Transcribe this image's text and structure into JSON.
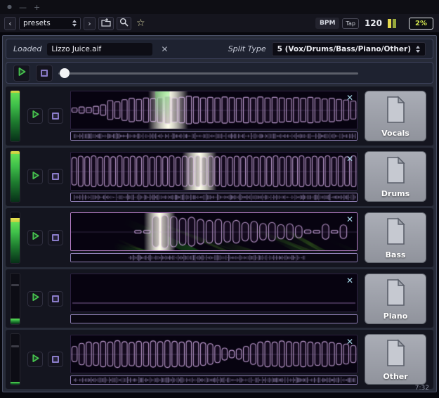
{
  "titlebar": {
    "dot": "●",
    "minimize": "—",
    "zoom": "+"
  },
  "glyphs": {
    "close": "✕",
    "back": "‹",
    "forward": "›",
    "star": "☆"
  },
  "toolbar": {
    "preset_value": "presets",
    "bpm_label": "BPM",
    "tap_label": "Tap",
    "bpm_value": "120",
    "cpu_value": "2%"
  },
  "file_bar": {
    "loaded_label": "Loaded",
    "file_name": "Lizzo Juice.aif",
    "split_type_label": "Split Type",
    "split_type_value": "5 (Vox/Drums/Bass/Piano/Other)"
  },
  "transport": {
    "position_pct": 2
  },
  "footer": {
    "time": "7:32"
  },
  "colors": {
    "accent_green": "#46c24e",
    "accent_purple": "#8a7cc9",
    "close_x": "#a7d9ea",
    "meter_yellow": "#e4d84b",
    "wave_outline": "#c6a2d8",
    "bass_border": "#b87fc8"
  },
  "tracks": [
    {
      "name": "Vocals",
      "meter": {
        "level": 0.95,
        "peak": true,
        "notch": false
      },
      "wave": {
        "style": "caps",
        "bg": "dark",
        "cap_r": 1.5,
        "border": false,
        "glow": {
          "x": 0.34,
          "w": 0.07,
          "beam": true
        },
        "envelope": [
          0.12,
          0.18,
          0.15,
          0.22,
          0.3,
          0.55,
          0.48,
          0.6,
          0.68,
          0.62,
          0.7,
          0.66,
          0.72,
          0.78,
          0.7,
          0.74,
          0.8,
          0.76,
          0.7,
          0.74,
          0.7,
          0.76,
          0.72,
          0.68,
          0.74,
          0.7,
          0.76,
          0.7,
          0.74,
          0.7,
          0.66,
          0.72,
          0.68,
          0.74,
          0.7,
          0.64,
          0.68,
          0.62,
          0.58,
          0.52
        ]
      },
      "strip": "full"
    },
    {
      "name": "Drums",
      "meter": {
        "level": 0.95,
        "peak": true,
        "notch": false
      },
      "wave": {
        "style": "caps",
        "bg": "dark",
        "cap_r": 4,
        "border": false,
        "glow": {
          "x": 0.45,
          "w": 0.06,
          "beam": false
        },
        "envelope": [
          0.8,
          0.88,
          0.84,
          0.9,
          0.82,
          0.88,
          0.84,
          0.9,
          0.82,
          0.88,
          0.84,
          0.9,
          0.82,
          0.88,
          0.84,
          0.9,
          0.82,
          0.88,
          0.84,
          0.9,
          0.82,
          0.88,
          0.84,
          0.9,
          0.82,
          0.88,
          0.84,
          0.9,
          0.82,
          0.88,
          0.84,
          0.9,
          0.82,
          0.88,
          0.84,
          0.9,
          0.82,
          0.88,
          0.84,
          0.9,
          0.82,
          0.88,
          0.84,
          0.9
        ]
      },
      "strip": "full"
    },
    {
      "name": "Bass",
      "meter": {
        "level": 0.8,
        "peak": true,
        "notch": false
      },
      "wave": {
        "style": "caps",
        "bg": "green",
        "cap_r": 5,
        "border": true,
        "glow": {
          "x": 0.31,
          "w": 0.055,
          "beam": false
        },
        "envelope": [
          0.02,
          0.02,
          0.03,
          0.02,
          0.03,
          0.04,
          0.03,
          0.05,
          0.08,
          0.9,
          0.96,
          0.88,
          0.78,
          0.84,
          0.72,
          0.66,
          0.72,
          0.6,
          0.66,
          0.54,
          0.6,
          0.48,
          0.54,
          0.42,
          0.46,
          0.36,
          0.1,
          0.05,
          0.44,
          0.05,
          0.4,
          0.04
        ]
      },
      "strip": "mid"
    },
    {
      "name": "Piano",
      "meter": {
        "level": 0.1,
        "peak": false,
        "notch": true
      },
      "wave": {
        "style": "flat",
        "bg": "dark",
        "cap_r": 3,
        "border": false,
        "glow": null,
        "envelope": []
      },
      "strip": "empty"
    },
    {
      "name": "Other",
      "meter": {
        "level": 0.06,
        "peak": false,
        "notch": true
      },
      "wave": {
        "style": "caps",
        "bg": "dark",
        "cap_r": 3.5,
        "border": false,
        "glow": null,
        "envelope": [
          0.45,
          0.62,
          0.7,
          0.66,
          0.74,
          0.7,
          0.78,
          0.72,
          0.68,
          0.74,
          0.7,
          0.76,
          0.72,
          0.78,
          0.74,
          0.7,
          0.76,
          0.72,
          0.66,
          0.6,
          0.5,
          0.35,
          0.22,
          0.3,
          0.45,
          0.6,
          0.7,
          0.74,
          0.7,
          0.76,
          0.72,
          0.68,
          0.74,
          0.7,
          0.66,
          0.72,
          0.68,
          0.62,
          0.58,
          0.5
        ]
      },
      "strip": "full"
    }
  ]
}
